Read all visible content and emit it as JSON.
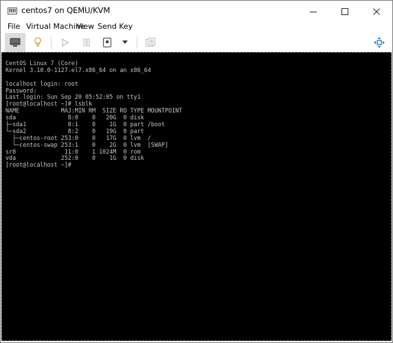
{
  "window": {
    "title": "centos7 on QEMU/KVM"
  },
  "menu": {
    "items": [
      "File",
      "Virtual Machine",
      "View",
      "Send Key"
    ]
  },
  "toolbar": {
    "buttons": [
      {
        "name": "console-view-button",
        "icon": "monitor-icon",
        "active": true
      },
      {
        "name": "details-view-button",
        "icon": "lightbulb-icon",
        "active": false
      },
      {
        "name": "run-button",
        "icon": "play-icon",
        "active": false
      },
      {
        "name": "pause-button",
        "icon": "pause-icon",
        "active": false
      },
      {
        "name": "shutdown-button",
        "icon": "power-icon",
        "active": false
      },
      {
        "name": "shutdown-menu-button",
        "icon": "chevron-down-icon",
        "active": false
      },
      {
        "name": "snapshots-button",
        "icon": "snapshot-icon",
        "active": false
      },
      {
        "name": "fullscreen-button",
        "icon": "resize-arrows-icon",
        "active": false
      }
    ]
  },
  "console": {
    "lines": [
      "CentOS Linux 7 (Core)",
      "Kernel 3.10.0-1127.el7.x86_64 on an x86_64",
      "",
      "localhost login: root",
      "Password:",
      "Last login: Sun Sep 20 05:52:05 on tty1",
      "[root@localhost ~]# lsblk",
      "NAME            MAJ:MIN RM  SIZE RO TYPE MOUNTPOINT",
      "sda               8:0    0   20G  0 disk",
      "├─sda1            8:1    0    1G  0 part /boot",
      "└─sda2            8:2    0   19G  0 part",
      "  ├─centos-root 253:0    0   17G  0 lvm  /",
      "  └─centos-swap 253:1    0    2G  0 lvm  [SWAP]",
      "sr0              11:0    1 1024M  0 rom",
      "vda             252:0    0    1G  0 disk",
      "[root@localhost ~]#"
    ]
  },
  "colors": {
    "console_bg": "#000000",
    "console_fg": "#c6c6c6",
    "icon_active": "#4a4a4a",
    "icon_disabled": "#b8b8b8"
  }
}
